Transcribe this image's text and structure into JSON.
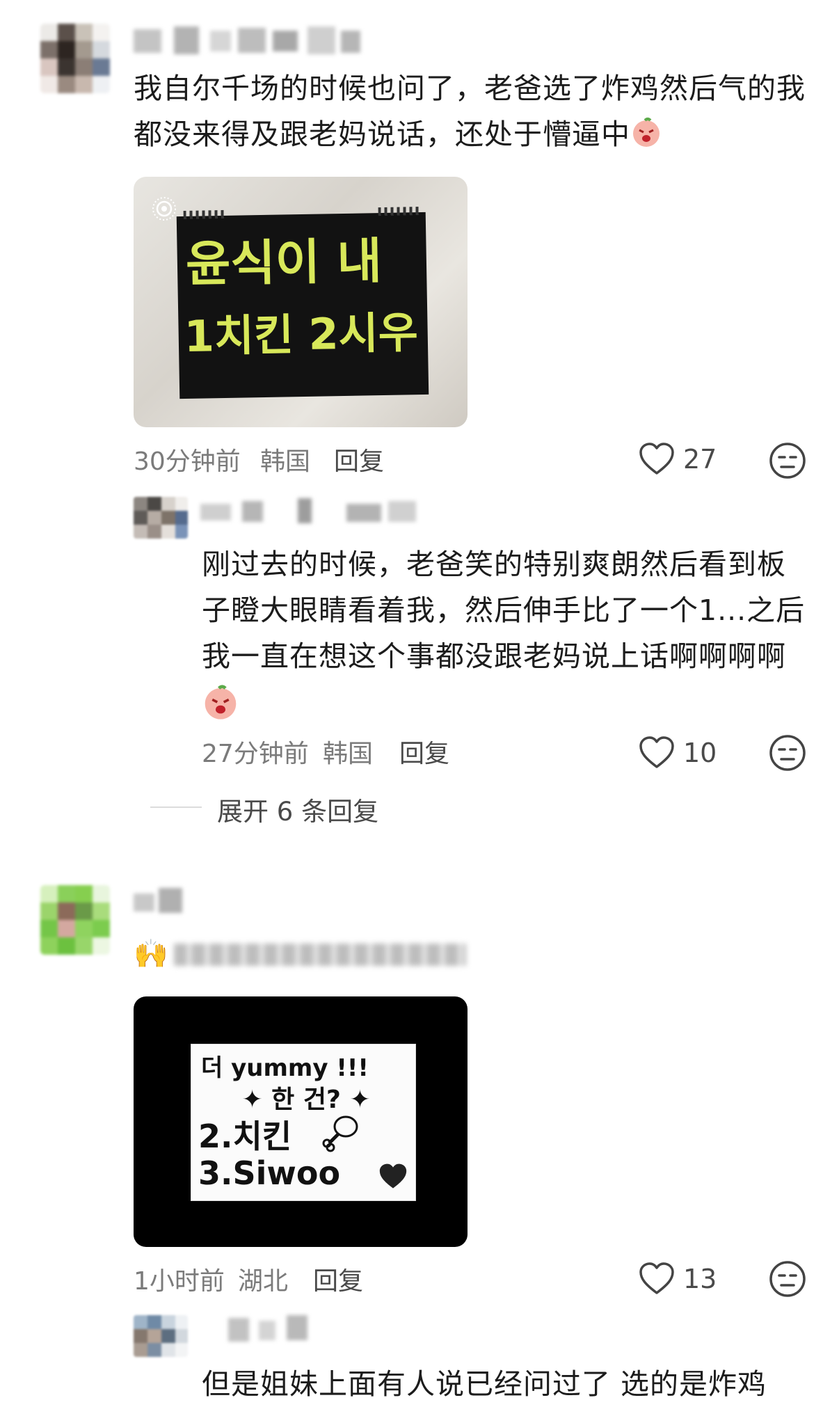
{
  "comments": [
    {
      "text_line1": "我自尔千场的时候也问了，老爸选了炸鸡然后气的我",
      "text_line2": "都没来得及跟老妈说话，还处于懵逼中",
      "image": {
        "line1": "윤식이 내",
        "line2": "1치킨 2시우"
      },
      "time": "30分钟前",
      "location": "韩国",
      "reply_label": "回复",
      "likes": "27",
      "replies": [
        {
          "text_line1": "刚过去的时候，老爸笑的特别爽朗然后看到板",
          "text_line2": "子瞪大眼睛看着我，然后伸手比了一个1...之后",
          "text_line3": "我一直在想这个事都没跟老妈说上话啊啊啊啊",
          "time": "27分钟前",
          "location": "韩国",
          "reply_label": "回复",
          "likes": "10"
        }
      ],
      "expand_label": "展开 6 条回复"
    },
    {
      "text_emoji": "🙌",
      "image": {
        "line1": "더 yummy !!!",
        "line2": "한 건?",
        "line3": "2.치킨",
        "line4": "3.Siwoo"
      },
      "time": "1小时前",
      "location": "湖北",
      "reply_label": "回复",
      "likes": "13",
      "replies": [
        {
          "text_line1": "但是姐妹上面有人说已经问过了 选的是炸鸡"
        }
      ]
    }
  ],
  "icons": {
    "like": "heart-outline-icon",
    "dislike": "meh-face-icon",
    "emoji": "crying-peach-emoji"
  },
  "colors": {
    "text": "#1c1c1c",
    "meta": "#7b7b7b",
    "icon": "#444444",
    "sign_yellow": "#d8e85a"
  }
}
